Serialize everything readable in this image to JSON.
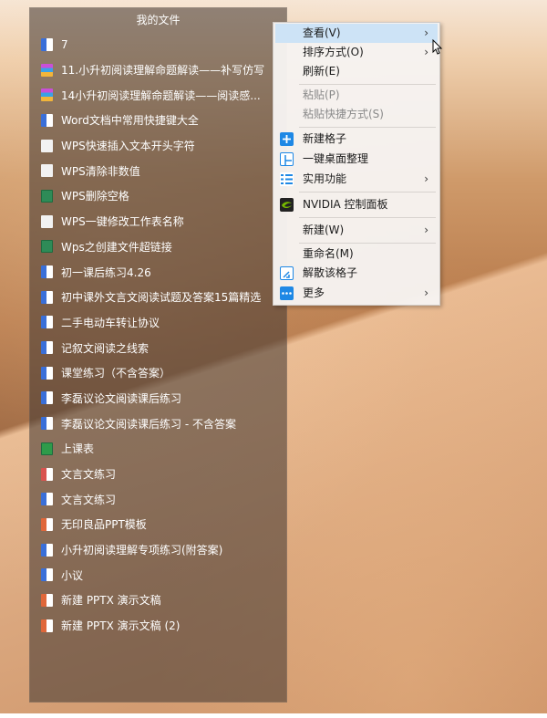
{
  "fence": {
    "title": "我的文件",
    "items": [
      {
        "label": "7",
        "icon": "word-doc-icon",
        "color": "#3a6fd8"
      },
      {
        "label": "11.小升初阅读理解命题解读——补写仿写",
        "icon": "rar-archive-icon",
        "color": "#9a3ea8"
      },
      {
        "label": "14小升初阅读理解命题解读——阅读感...",
        "icon": "rar-archive-icon",
        "color": "#9a3ea8"
      },
      {
        "label": "Word文档中常用快捷键大全",
        "icon": "word-doc-icon",
        "color": "#3a6fd8"
      },
      {
        "label": "WPS快速插入文本开头字符",
        "icon": "blank-file-icon",
        "color": "#f2f2f2"
      },
      {
        "label": "WPS清除非数值",
        "icon": "blank-file-icon",
        "color": "#f2f2f2"
      },
      {
        "label": "WPS删除空格",
        "icon": "spreadsheet-icon",
        "color": "#2e8b57"
      },
      {
        "label": "WPS一键修改工作表名称",
        "icon": "blank-file-icon",
        "color": "#f2f2f2"
      },
      {
        "label": "Wps之创建文件超链接",
        "icon": "spreadsheet-icon",
        "color": "#2e8b57"
      },
      {
        "label": "初一课后练习4.26",
        "icon": "word-doc-icon",
        "color": "#3a6fd8"
      },
      {
        "label": "初中课外文言文阅读试题及答案15篇精选",
        "icon": "word-doc-icon",
        "color": "#3a6fd8"
      },
      {
        "label": "二手电动车转让协议",
        "icon": "word-doc-icon",
        "color": "#3a6fd8"
      },
      {
        "label": "记叙文阅读之线索",
        "icon": "word-doc-icon",
        "color": "#3a6fd8"
      },
      {
        "label": "课堂练习（不含答案）",
        "icon": "word-doc-icon",
        "color": "#3a6fd8"
      },
      {
        "label": "李磊议论文阅读课后练习",
        "icon": "word-doc-icon",
        "color": "#3a6fd8"
      },
      {
        "label": "李磊议论文阅读课后练习 - 不含答案",
        "icon": "word-doc-icon",
        "color": "#3a6fd8"
      },
      {
        "label": "上课表",
        "icon": "spreadsheet-icon",
        "color": "#2e9b4a"
      },
      {
        "label": "文言文练习",
        "icon": "pdf-icon",
        "color": "#d9534f"
      },
      {
        "label": "文言文练习",
        "icon": "word-doc-icon",
        "color": "#3a6fd8"
      },
      {
        "label": "无印良品PPT模板",
        "icon": "ppt-icon",
        "color": "#e0673a"
      },
      {
        "label": "小升初阅读理解专项练习(附答案)",
        "icon": "word-doc-icon",
        "color": "#3a6fd8"
      },
      {
        "label": "小议",
        "icon": "word-doc-icon",
        "color": "#3a6fd8"
      },
      {
        "label": "新建 PPTX 演示文稿",
        "icon": "ppt-icon",
        "color": "#e0673a"
      },
      {
        "label": "新建 PPTX 演示文稿 (2)",
        "icon": "ppt-icon",
        "color": "#e0673a"
      }
    ]
  },
  "menu": {
    "view": "查看(V)",
    "sort": "排序方式(O)",
    "refresh": "刷新(E)",
    "paste": "粘贴(P)",
    "paste_shortcut": "粘贴快捷方式(S)",
    "new_fence": "新建格子",
    "one_click_organize": "一键桌面整理",
    "utilities": "实用功能",
    "nvidia": "NVIDIA 控制面板",
    "new": "新建(W)",
    "rename": "重命名(M)",
    "dissolve": "解散该格子",
    "more": "更多",
    "arrow": "›"
  },
  "colors": {
    "menu_highlight": "#cde3f6",
    "accent_blue": "#1e88e5",
    "nvidia_green": "#76b900"
  }
}
